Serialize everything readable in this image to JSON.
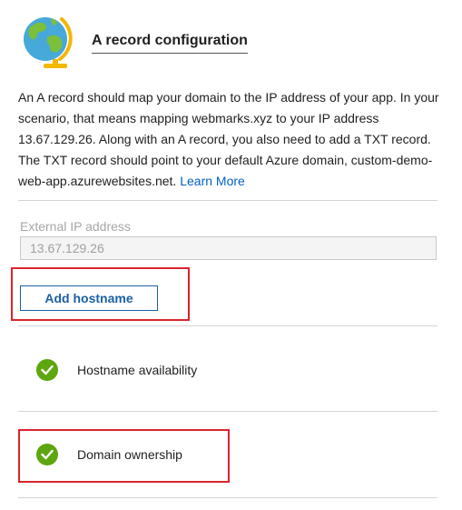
{
  "header": {
    "icon": "globe-icon",
    "title": "A record configuration"
  },
  "description": {
    "text": "An A record should map your domain to the IP address of your app. In your scenario, that means mapping webmarks.xyz to your IP address 13.67.129.26. Along with an A record, you also need to add a TXT record. The TXT record should point to your default Azure domain, custom-demo-web-app.azurewebsites.net. ",
    "link_label": "Learn More"
  },
  "ip_field": {
    "label": "External IP address",
    "value": "13.67.129.26"
  },
  "add_hostname": {
    "label": "Add hostname"
  },
  "checks": [
    {
      "label": "Hostname availability",
      "icon": "checkmark-icon",
      "status_color": "#5ea60f"
    },
    {
      "label": "Domain ownership",
      "icon": "checkmark-icon",
      "status_color": "#5ea60f"
    }
  ],
  "colors": {
    "accent": "#1a5fa6",
    "link": "#0062c4",
    "highlight": "#d9252c"
  }
}
